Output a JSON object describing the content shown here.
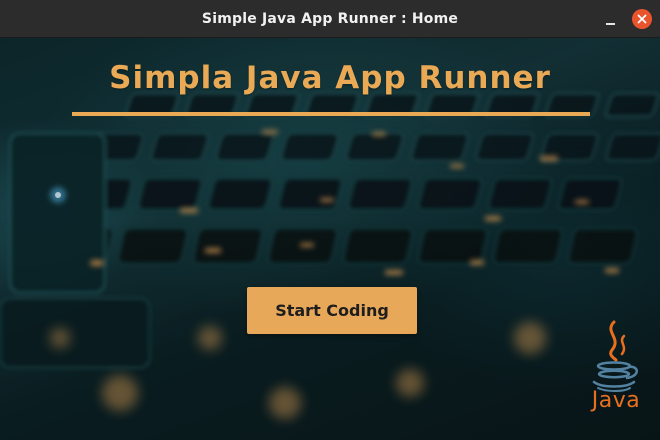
{
  "window": {
    "title": "Simple Java App Runner : Home"
  },
  "home": {
    "heading": "Simpla Java App Runner",
    "start_button_label": "Start Coding"
  },
  "logo": {
    "icon": "java-coffee-cup-icon",
    "text": "Java"
  },
  "colors": {
    "accent": "#e9a955",
    "button_bg": "#e8a85a",
    "close_button": "#e9542d",
    "titlebar": "#2c2c2c",
    "java_orange": "#e76f1e",
    "java_blue": "#5382a1"
  }
}
